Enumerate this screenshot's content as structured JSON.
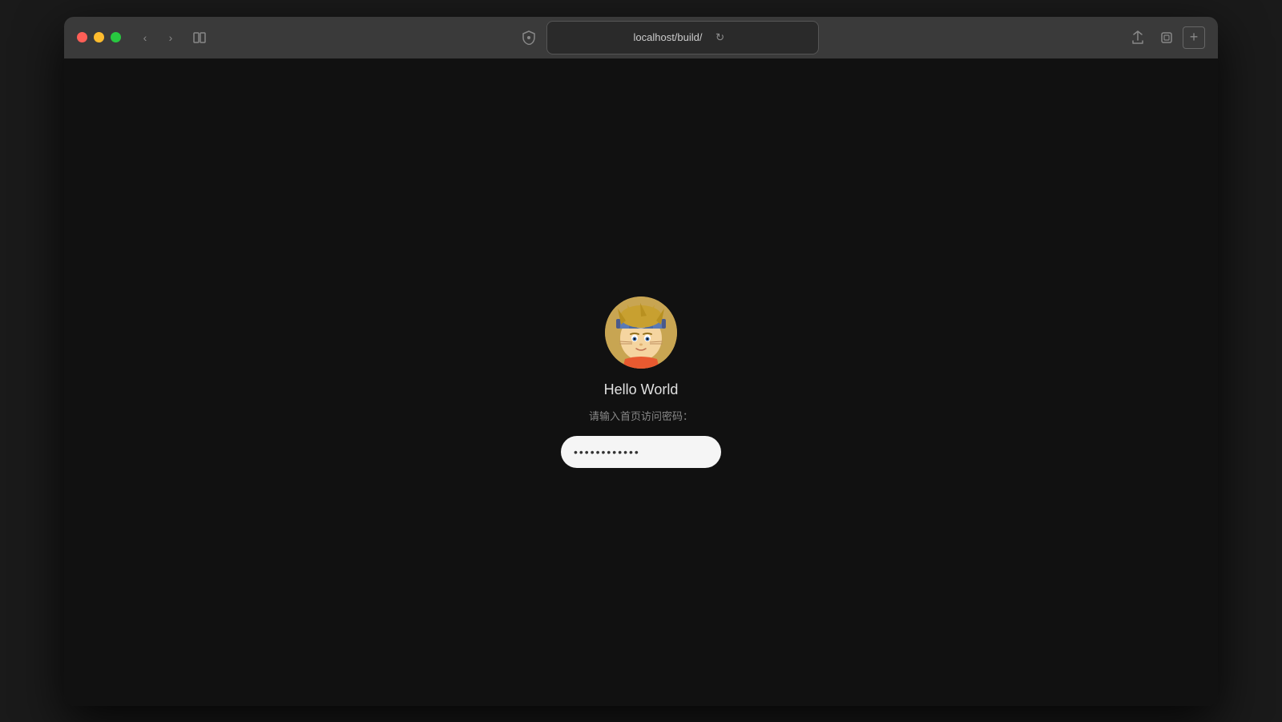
{
  "browser": {
    "url": "localhost/build/",
    "title": "localhost/build/",
    "traffic_lights": {
      "close_color": "#ff5f57",
      "minimize_color": "#febc2e",
      "maximize_color": "#28c840"
    },
    "toolbar": {
      "back_label": "‹",
      "forward_label": "›",
      "sidebar_label": "⊞",
      "reload_label": "↻",
      "share_label": "⬆",
      "window_label": "⊡",
      "add_tab_label": "+"
    }
  },
  "page": {
    "user_name": "Hello World",
    "prompt_text": "请输入首页访问密码：",
    "password_value": "············",
    "submit_arrow": "→",
    "avatar_alt": "Naruto character avatar",
    "accent_color": "#4caf50"
  }
}
